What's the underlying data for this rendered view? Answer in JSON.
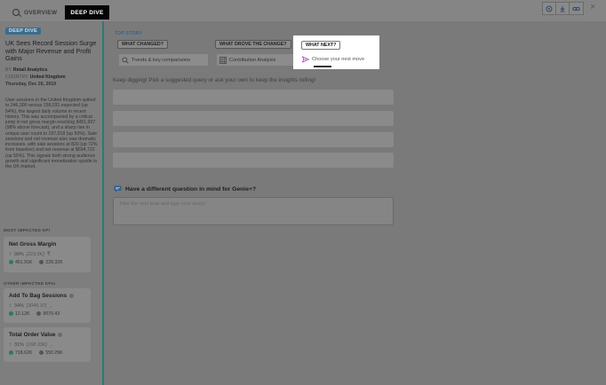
{
  "tabs": [
    {
      "label": "OVERVIEW",
      "active": false
    },
    {
      "label": "DEEP DIVE",
      "active": true
    }
  ],
  "toolbar": {
    "icons": [
      "target-icon",
      "download-icon",
      "link-icon"
    ],
    "close": "×"
  },
  "sidebar": {
    "badge": "DEEP DIVE",
    "title": "UK Sees Record Session Surge with Major Revenue and Profit Gains",
    "meta": [
      {
        "label": "BY",
        "value": "Retail Analytics"
      },
      {
        "label": "COUNTRY",
        "value": "United Kingdom"
      }
    ],
    "date": "Thursday, Dec 26, 2019",
    "body": "User sessions in the United Kingdom spiked to 246,300 versus 158,031 expected (up 54%), the largest daily volume in recent history. This was accompanied by a critical jump in net gross margin reaching $451,907 (98% above forecast), and a sharp rise in unique user count to 197,018 (up 50%). Sale sessions and net revenue also saw dramatic increases, with sale sessions at 820 (up 72% from baseline) and net revenue at $694,722 (up 55%). This signals both strong audience growth and significant monetization upside in the UK market.",
    "most_impacted_label": "MOST IMPACTED KPI",
    "other_impacted_label": "OTHER IMPACTED KPIs",
    "kpis": [
      {
        "name": "Net Gross Margin",
        "change": "99%",
        "delta": "[223.6K]",
        "actual": "451.91K",
        "expected": "228.32K"
      },
      {
        "name": "Add To Bag Sessions",
        "change": "34%",
        "delta": "[3045.37]",
        "actual": "12.12K",
        "expected": "9070.43"
      },
      {
        "name": "Total Order Value",
        "change": "31%",
        "delta": "[168.33K]",
        "actual": "718.62K",
        "expected": "550.29K"
      }
    ]
  },
  "main": {
    "top_story_label": "TOP STORY",
    "questions": [
      {
        "label": "WHAT CHANGED?",
        "sub": "Trends & key comparisons"
      },
      {
        "label": "WHAT DROVE THE CHANGE?",
        "sub": "Contribution Analysis"
      },
      {
        "label": "WHAT NEXT?",
        "sub": "Choose your next move"
      }
    ],
    "keep_digging": "Keep digging! Pick a suggested query or ask your own to keep the insights rolling!",
    "question_heading": "Have a different question in mind for Genie+?",
    "input_placeholder": "Take the next leap and type your query!"
  },
  "colors": {
    "accent": "#2e7a74",
    "badge": "#3a6d8c",
    "highlight": "#ffffff"
  }
}
